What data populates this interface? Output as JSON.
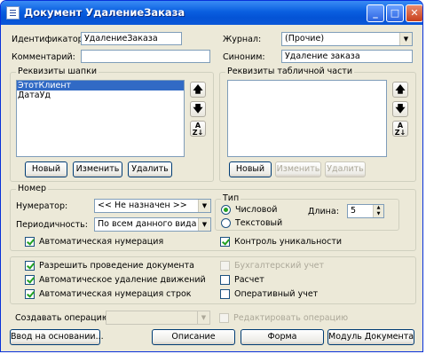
{
  "window": {
    "title": "Документ УдалениеЗаказа"
  },
  "header": {
    "id_label": "Идентификатор:",
    "id_value": "УдалениеЗаказа",
    "comment_label": "Комментарий:",
    "comment_value": "",
    "journal_label": "Журнал:",
    "journal_value": "(Прочие)",
    "synonym_label": "Синоним:",
    "synonym_value": "Удаление заказа"
  },
  "header_req": {
    "title": "Реквизиты шапки",
    "items": [
      "ЭтотКлиент",
      "ДатаУд"
    ],
    "new": "Новый",
    "edit": "Изменить",
    "delete": "Удалить"
  },
  "table_req": {
    "title": "Реквизиты табличной части",
    "new": "Новый",
    "edit": "Изменить",
    "delete": "Удалить"
  },
  "number": {
    "title": "Номер",
    "numerator_label": "Нумератор:",
    "numerator_value": "<< Не назначен >>",
    "period_label": "Периодичность:",
    "period_value": "По всем данного вида",
    "auto_label": "Автоматическая нумерация",
    "auto_checked": true,
    "type_title": "Тип",
    "numeric_label": "Числовой",
    "text_label": "Текстовый",
    "numeric_selected": true,
    "length_label": "Длина:",
    "length_value": "5",
    "unique_label": "Контроль уникальности",
    "unique_checked": true
  },
  "options": {
    "allow_posting": "Разрешить проведение документа",
    "auto_delete": "Автоматическое удаление движений",
    "auto_row_num": "Автоматическая нумерация строк",
    "accounting": "Бухгалтерский учет",
    "calc": "Расчет",
    "operational": "Оперативный учет"
  },
  "operation": {
    "create_label": "Создавать операцию:",
    "create_value": "",
    "edit_label": "Редактировать операцию"
  },
  "footer": {
    "basis": "Ввод на основании...",
    "description": "Описание",
    "form": "Форма",
    "module": "Модуль Документа"
  },
  "icons": {
    "up": "up-arrow-icon",
    "down": "down-arrow-icon",
    "sort": "sort-az-icon"
  }
}
